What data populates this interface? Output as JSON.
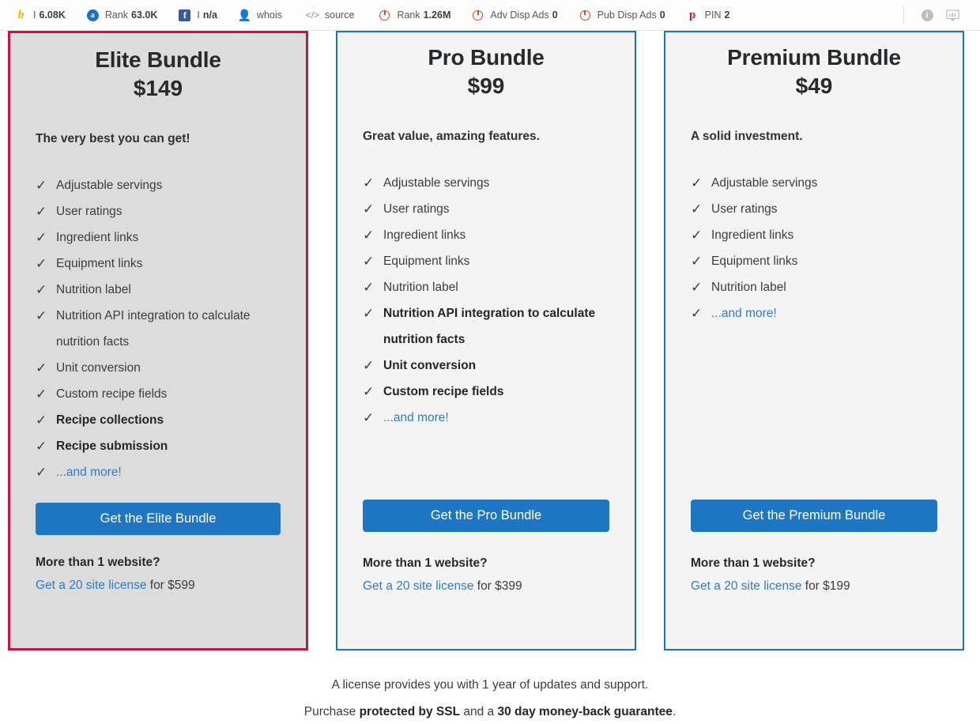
{
  "toolbar": {
    "metrics": [
      {
        "icon": "bing-icon",
        "label": "I",
        "value": "6.08K"
      },
      {
        "icon": "alexa-icon",
        "label": "Rank",
        "value": "63.0K"
      },
      {
        "icon": "facebook-icon",
        "label": "I",
        "value": "n/a"
      },
      {
        "icon": "whois-icon",
        "label": "whois",
        "value": ""
      },
      {
        "icon": "source-icon",
        "label": "source",
        "value": ""
      },
      {
        "icon": "semrush-icon",
        "label": "Rank",
        "value": "1.26M"
      },
      {
        "icon": "semrush-icon",
        "label": "Adv Disp Ads",
        "value": "0"
      },
      {
        "icon": "semrush-icon",
        "label": "Pub Disp Ads",
        "value": "0"
      },
      {
        "icon": "pinterest-icon",
        "label": "PIN",
        "value": "2"
      }
    ],
    "right_icons": [
      {
        "icon": "info-icon"
      },
      {
        "icon": "dashboard-icon"
      }
    ]
  },
  "colors": {
    "elite_border": "#c2173f",
    "card_border": "#1a73c4",
    "cta": "#1f77c4",
    "link": "#2e7cc4",
    "elite_bg": "#dcdcdc",
    "card_bg": "#f4f4f4"
  },
  "cards": [
    {
      "name": "elite",
      "title": "Elite Bundle",
      "price": "$149",
      "tagline": "The very best you can get!",
      "features": [
        {
          "text": "Adjustable servings",
          "bold": false,
          "link": false
        },
        {
          "text": "User ratings",
          "bold": false,
          "link": false
        },
        {
          "text": "Ingredient links",
          "bold": false,
          "link": false
        },
        {
          "text": "Equipment links",
          "bold": false,
          "link": false
        },
        {
          "text": "Nutrition label",
          "bold": false,
          "link": false
        },
        {
          "text": "Nutrition API integration to calculate nutrition facts",
          "bold": false,
          "link": false
        },
        {
          "text": "Unit conversion",
          "bold": false,
          "link": false
        },
        {
          "text": "Custom recipe fields",
          "bold": false,
          "link": false
        },
        {
          "text": "Recipe collections",
          "bold": true,
          "link": false
        },
        {
          "text": "Recipe submission",
          "bold": true,
          "link": false
        },
        {
          "text": "...and more!",
          "bold": false,
          "link": true
        }
      ],
      "cta": "Get the Elite Bundle",
      "multi_question": "More than 1 website?",
      "multi_link": "Get a 20 site license",
      "multi_suffix": " for $599"
    },
    {
      "name": "pro",
      "title": "Pro Bundle",
      "price": "$99",
      "tagline": "Great value, amazing features.",
      "features": [
        {
          "text": "Adjustable servings",
          "bold": false,
          "link": false
        },
        {
          "text": "User ratings",
          "bold": false,
          "link": false
        },
        {
          "text": "Ingredient links",
          "bold": false,
          "link": false
        },
        {
          "text": "Equipment links",
          "bold": false,
          "link": false
        },
        {
          "text": "Nutrition label",
          "bold": false,
          "link": false
        },
        {
          "text": "Nutrition API integration to calculate nutrition facts",
          "bold": true,
          "link": false
        },
        {
          "text": "Unit conversion",
          "bold": true,
          "link": false
        },
        {
          "text": "Custom recipe fields",
          "bold": true,
          "link": false
        },
        {
          "text": "...and more!",
          "bold": false,
          "link": true
        }
      ],
      "cta": "Get the Pro Bundle",
      "multi_question": "More than 1 website?",
      "multi_link": "Get a 20 site license",
      "multi_suffix": " for $399"
    },
    {
      "name": "premium",
      "title": "Premium Bundle",
      "price": "$49",
      "tagline": "A solid investment.",
      "features": [
        {
          "text": "Adjustable servings",
          "bold": false,
          "link": false
        },
        {
          "text": "User ratings",
          "bold": false,
          "link": false
        },
        {
          "text": "Ingredient links",
          "bold": false,
          "link": false
        },
        {
          "text": "Equipment links",
          "bold": false,
          "link": false
        },
        {
          "text": "Nutrition label",
          "bold": false,
          "link": false
        },
        {
          "text": "...and more!",
          "bold": false,
          "link": true
        }
      ],
      "cta": "Get the Premium Bundle",
      "multi_question": "More than 1 website?",
      "multi_link": "Get a 20 site license",
      "multi_suffix": " for $199"
    }
  ],
  "footer": {
    "line1": "A license provides you with 1 year of updates and support.",
    "line2_prefix": "Purchase ",
    "line2_bold1": "protected by SSL",
    "line2_mid": " and a ",
    "line2_bold2": "30 day money-back guarantee",
    "line2_suffix": "."
  }
}
